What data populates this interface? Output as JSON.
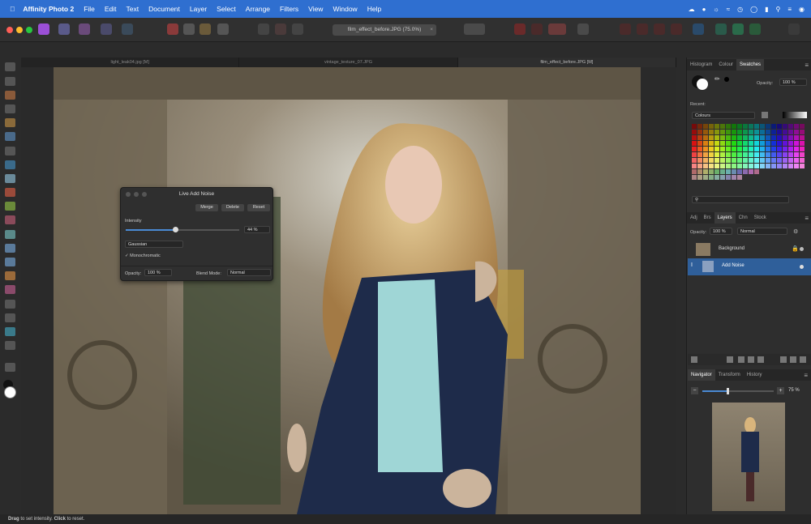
{
  "menubar": {
    "app": "Affinity Photo 2",
    "items": [
      "File",
      "Edit",
      "Text",
      "Document",
      "Layer",
      "Select",
      "Arrange",
      "Filters",
      "View",
      "Window",
      "Help"
    ]
  },
  "toolbar": {
    "document_pill": "film_effect_before.JPG (75.0%)"
  },
  "tabs": [
    "light_leak04.jpg [M]",
    "vintage_texture_07.JPG",
    "film_effect_before.JPG [M]"
  ],
  "dialog": {
    "title": "Live Add Noise",
    "merge": "Merge",
    "delete": "Delete",
    "reset": "Reset",
    "intensity_label": "Intensity",
    "intensity_value": "44 %",
    "intensity_fraction": 0.44,
    "noise_type": "Gaussian",
    "monochromatic": "Monochromatic",
    "opacity_label": "Opacity:",
    "opacity_value": "100 %",
    "blend_label": "Blend Mode:",
    "blend_value": "Normal"
  },
  "colour_panel": {
    "tabs": [
      "Histogram",
      "Colour",
      "Swatches"
    ],
    "opacity_label": "Opacity:",
    "opacity_value": "100 %",
    "recent_label": "Recent:",
    "palette": "Colours"
  },
  "layers_panel": {
    "tabs": [
      "Adj",
      "Brs",
      "Layers",
      "Chn",
      "Stock"
    ],
    "opacity_label": "Opacity:",
    "opacity_value": "100 %",
    "blend_value": "Normal",
    "layers": [
      {
        "name": "Background"
      },
      {
        "name": "Add Noise"
      }
    ]
  },
  "navigator": {
    "tabs": [
      "Navigator",
      "Transform",
      "History"
    ],
    "zoom": "75 %",
    "zoom_fraction": 0.36
  },
  "status": {
    "drag": "Drag",
    "text1": " to set intensity. ",
    "click": "Click",
    "text2": " to reset."
  }
}
